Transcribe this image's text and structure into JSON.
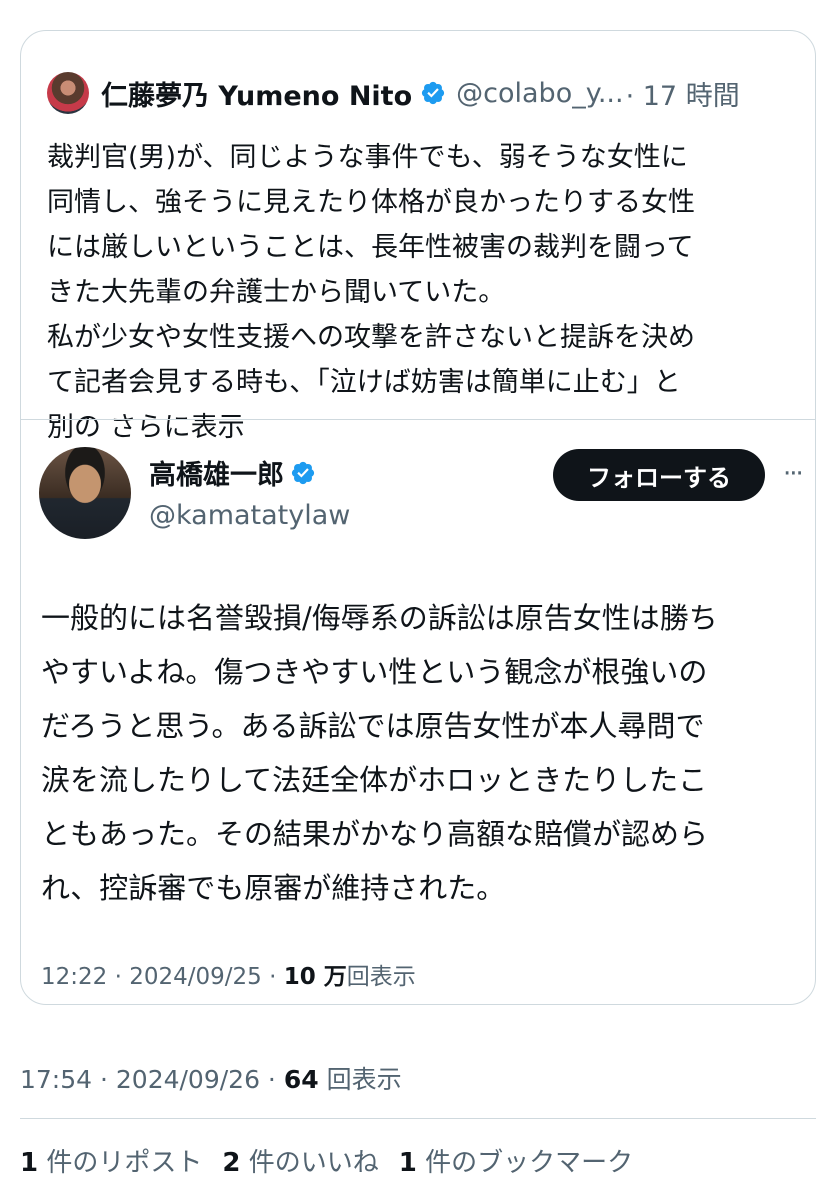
{
  "quoted": {
    "name": "仁藤夢乃 Yumeno Nito",
    "handle": "@colabo_y...",
    "time": "· 17 時間",
    "text": "裁判官(男)が、同じような事件でも、弱そうな女性に\n同情し、強そうに見えたり体格が良かったりする女性\nには厳しいということは、長年性被害の裁判を闘って\nきた大先輩の弁護士から聞いていた。\n私が少女や女性支援への攻撃を許さないと提訴を決め\nて記者会見する時も、「泣けば妨害は簡単に止む」と\n別の",
    "show_more": "さらに表示"
  },
  "embedded": {
    "name": "高橋雄一郎",
    "handle": "@kamatatylaw",
    "follow_label": "フォローする",
    "more_icon": "···",
    "text": "一般的には名誉毀損/侮辱系の訴訟は原告女性は勝ち\nやすいよね。傷つきやすい性という観念が根強いの\nだろうと思う。ある訴訟では原告女性が本人尋問で\n涙を流したりして法廷全体がホロッときたりしたこ\nともあった。その結果がかなり高額な賠償が認めら\nれ、控訴審でも原審が維持された。",
    "timestamp": "12:22 · 2024/09/25 · ",
    "views_count": "10 万",
    "views_label": "回表示"
  },
  "post": {
    "timestamp": "17:54 · 2024/09/26 · ",
    "views_count": "64",
    "views_label": " 回表示"
  },
  "stats": [
    {
      "count": "1",
      "label": " 件のリポスト"
    },
    {
      "count": "2",
      "label": " 件のいいね"
    },
    {
      "count": "1",
      "label": " 件のブックマーク"
    }
  ],
  "colors": {
    "verified": "#1d9bf0",
    "secondary_text": "#536471",
    "border": "#cfd9de"
  }
}
